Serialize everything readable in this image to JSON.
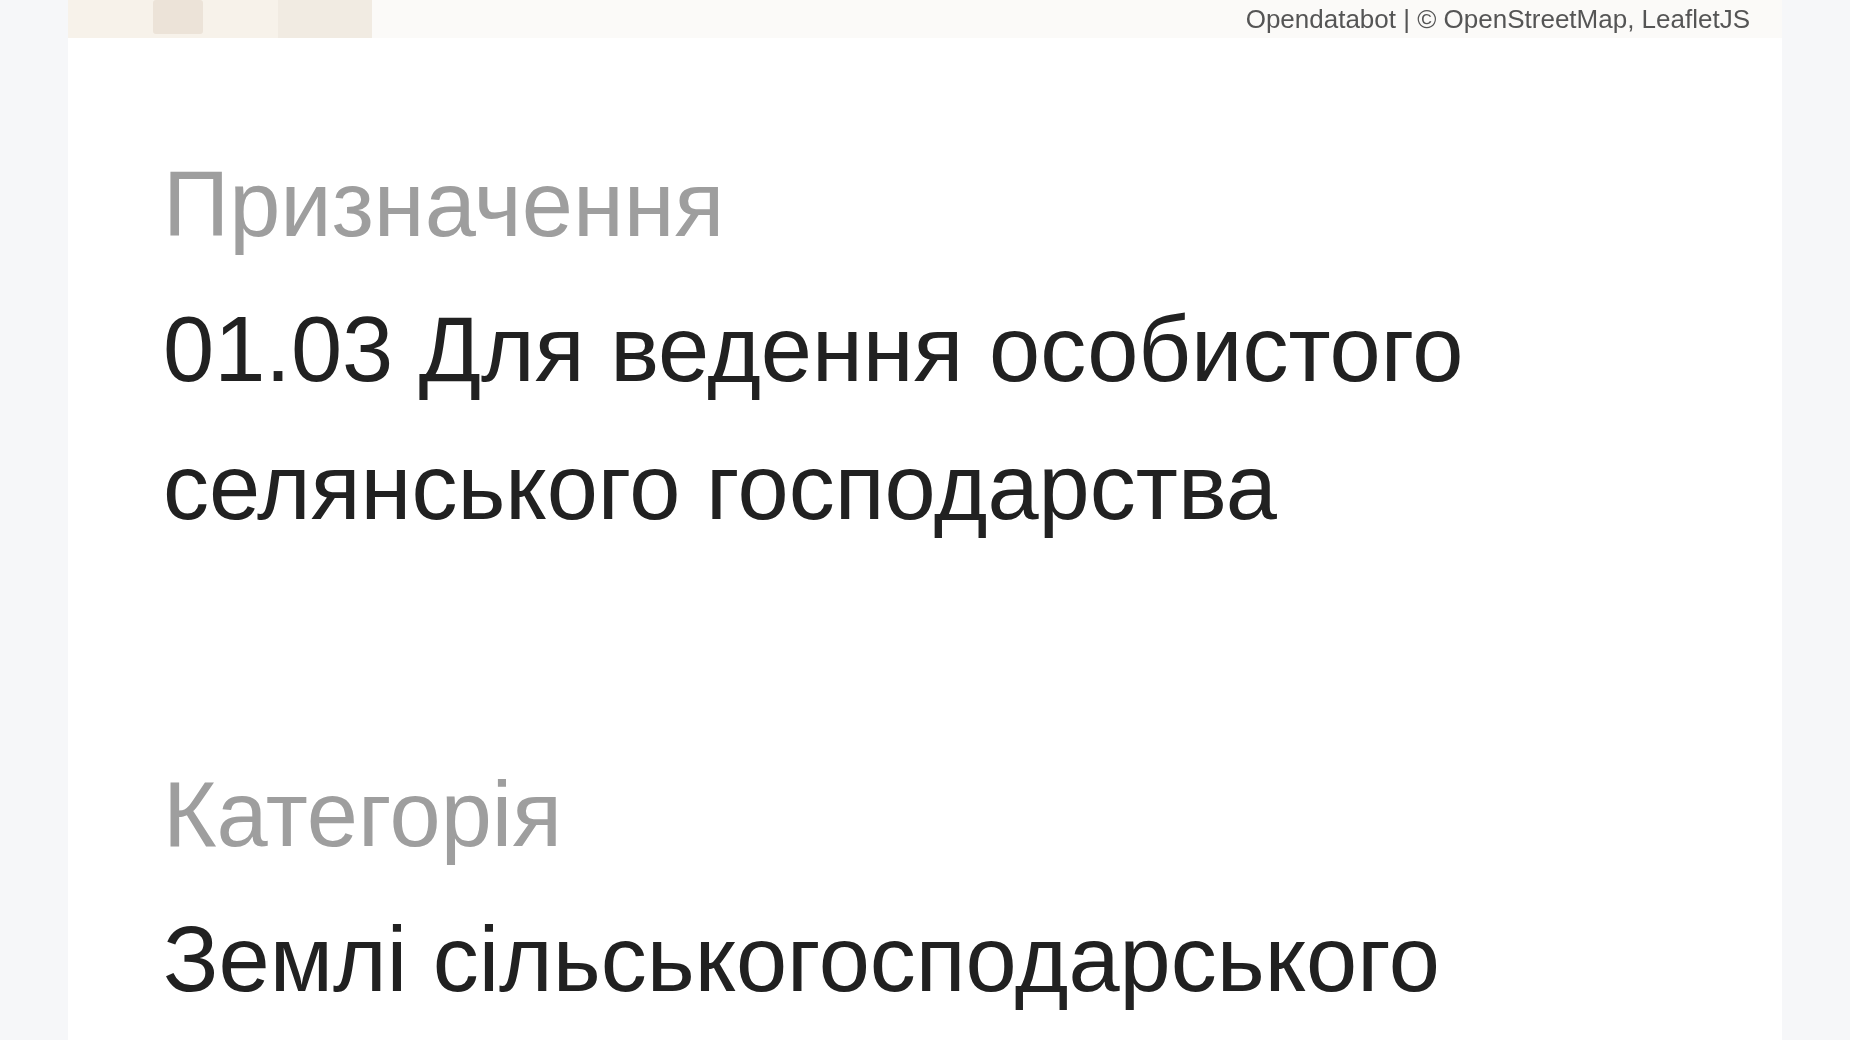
{
  "map": {
    "attribution": "Opendatabot | © OpenStreetMap, LeafletJS"
  },
  "fields": [
    {
      "label": "Призначення",
      "value": "01.03 Для ведення особистого селянського господарства"
    },
    {
      "label": "Категорія",
      "value": "Землі сільськогосподарського"
    }
  ]
}
